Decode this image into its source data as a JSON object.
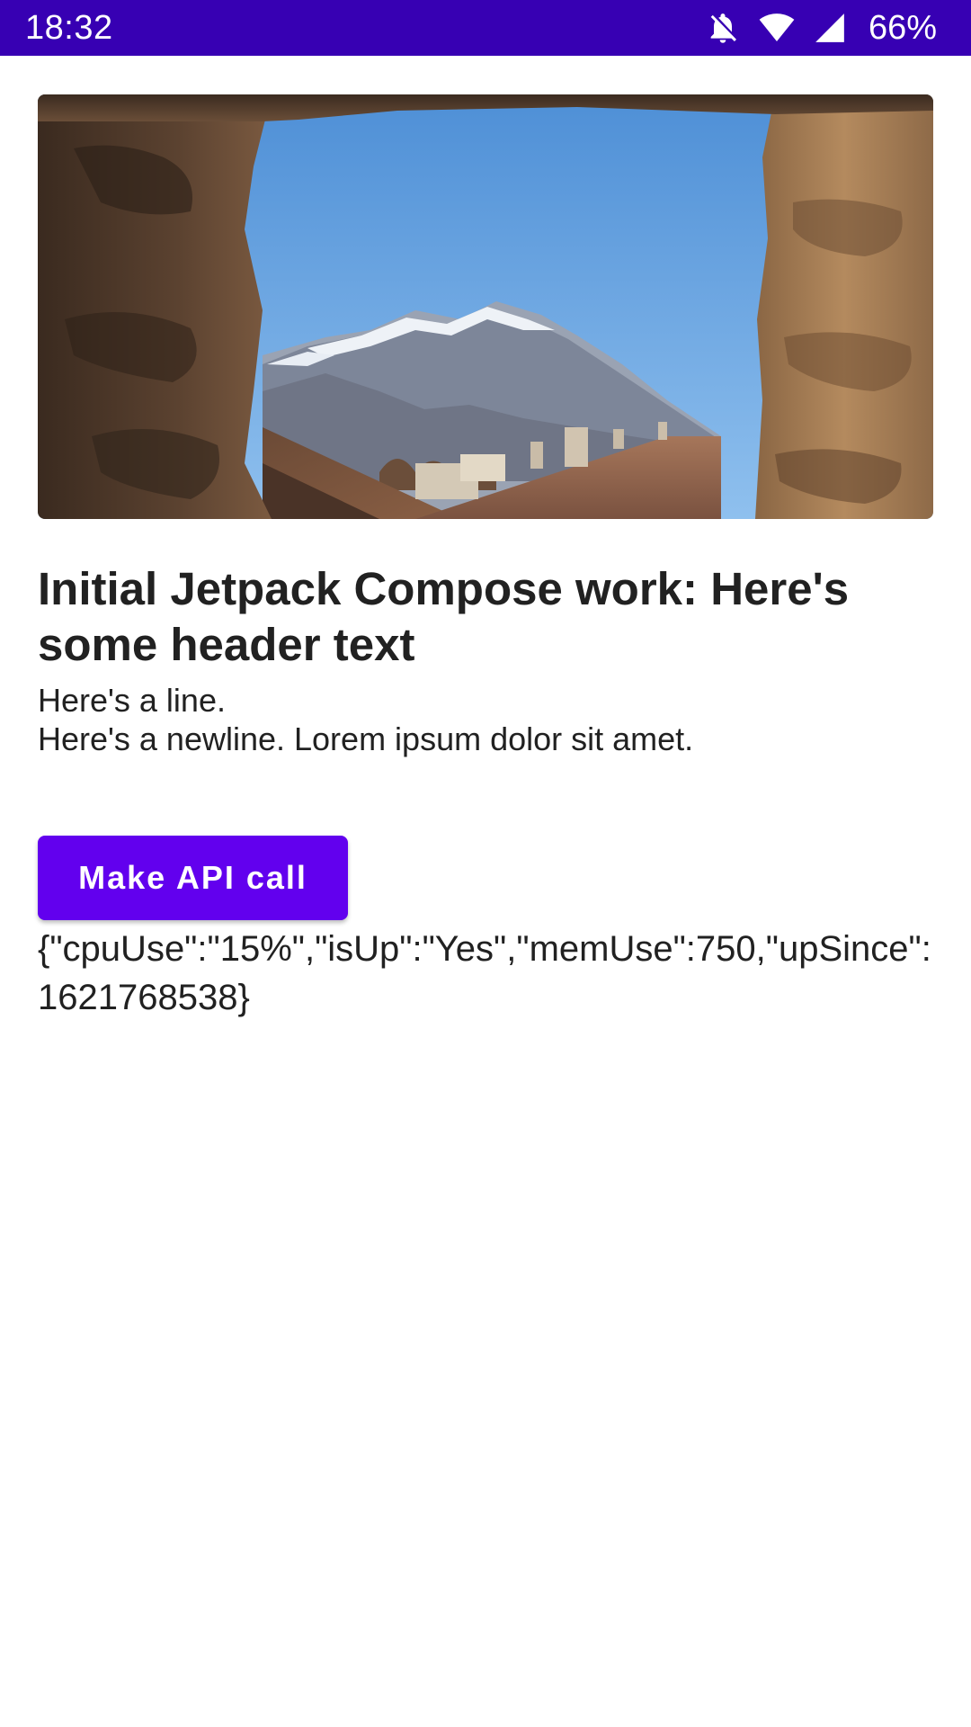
{
  "status_bar": {
    "time": "18:32",
    "battery": "66%",
    "icons": [
      "bell-off-icon",
      "wifi-icon",
      "cellular-signal-icon"
    ],
    "background_color": "#3700B3"
  },
  "hero_image": {
    "subject": "mountain-view-through-stone-window-photo"
  },
  "content": {
    "header": "Initial Jetpack Compose work: Here's some header text",
    "line_1": "Here's a line.",
    "line_2": "Here's a newline. Lorem ipsum dolor sit amet."
  },
  "api": {
    "button_label": "Make API call",
    "button_color": "#6200EE",
    "response": "{\"cpuUse\":\"15%\",\"isUp\":\"Yes\",\"memUse\":750,\"upSince\":1621768538}"
  }
}
